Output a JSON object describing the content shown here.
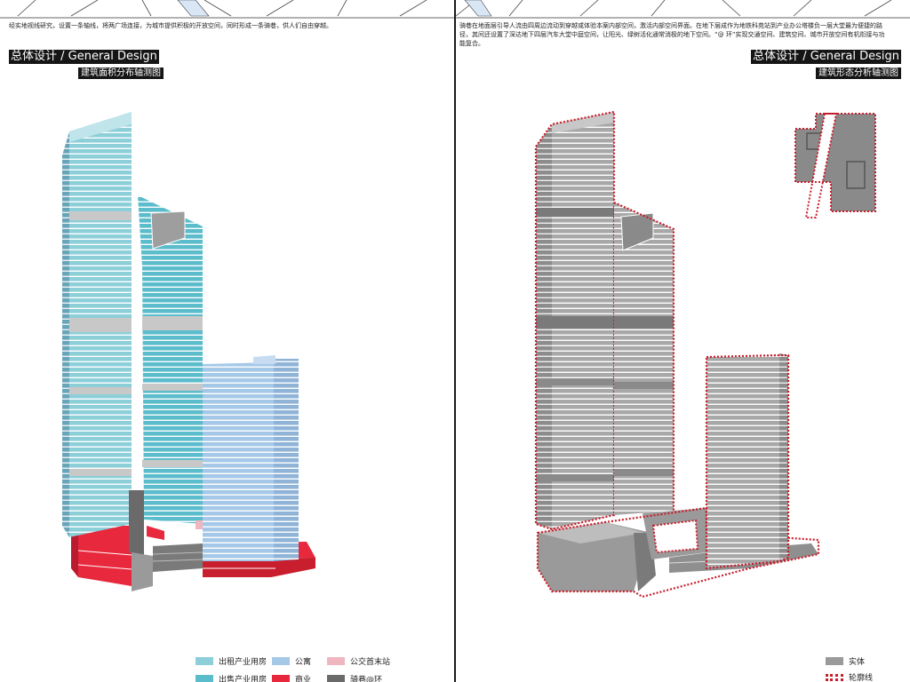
{
  "left": {
    "intro": "经实地视线研究，设置一条轴线，将两广场连接，为城市提供积极的开放空间，同时形成一条骑巷，供人们自由穿越。",
    "title": "总体设计 / General Design",
    "subtitle": "建筑面积分布轴测图",
    "legend": [
      {
        "label": "出租产业用房",
        "color": "#8ccfd9"
      },
      {
        "label": "公寓",
        "color": "#a5c8e8"
      },
      {
        "label": "公交首末站",
        "color": "#f0b6c0"
      },
      {
        "label": "出售产业用房",
        "color": "#5bbccb"
      },
      {
        "label": "商业",
        "color": "#e8283c"
      },
      {
        "label": "骑巷@环",
        "color": "#6a6a6a"
      }
    ]
  },
  "right": {
    "intro": "骑巷在地面层引导人流由四周边流动到穿越或体验本案内部空间，激活内部空间界面。在地下层成作为地铁科苑站到产业办公塔楼负一层大堂最为便捷的路径，其间还设置了深达地下四层汽车大堂中庭空间，让阳光、绿树活化通常消极的地下空间。“@ 环”实现交通空间、建筑空间、城市开放空间有机衔接与功能复合。",
    "title": "总体设计 / General Design",
    "subtitle": "建筑形态分析轴测图",
    "legend": [
      {
        "label": "实体",
        "color": "#9a9a9a"
      },
      {
        "label": "轮廓线",
        "color": "#c81e2b"
      }
    ]
  }
}
